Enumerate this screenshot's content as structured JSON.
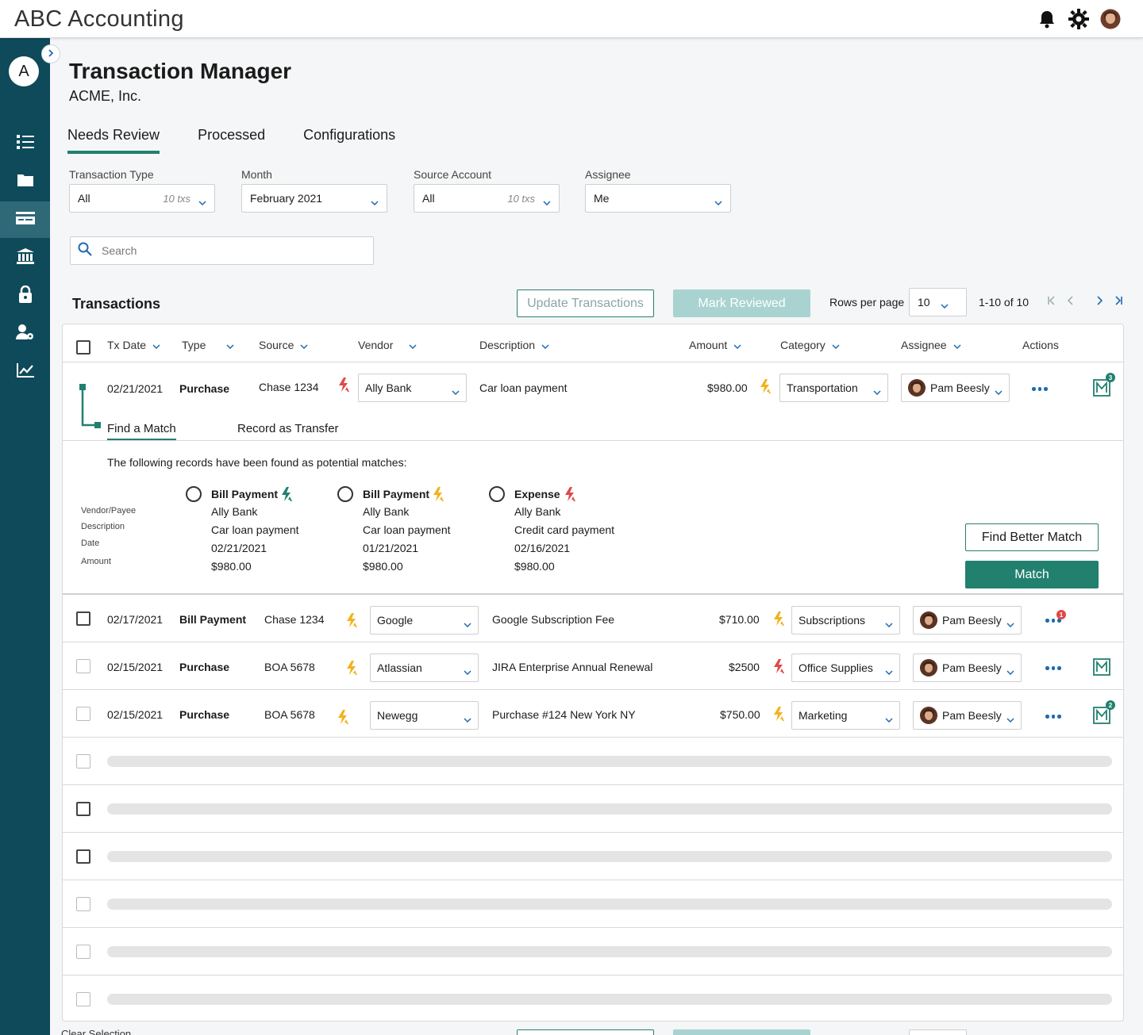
{
  "app": {
    "title": "ABC Accounting",
    "user_initial": "A"
  },
  "page": {
    "title": "Transaction Manager",
    "company": "ACME, Inc."
  },
  "tabs": [
    "Needs Review",
    "Processed",
    "Configurations"
  ],
  "filters": {
    "transaction_type": {
      "label": "Transaction Type",
      "value": "All",
      "count": "10 txs"
    },
    "month": {
      "label": "Month",
      "value": "February 2021"
    },
    "source_account": {
      "label": "Source Account",
      "value": "All",
      "count": "10 txs"
    },
    "assignee": {
      "label": "Assignee",
      "value": "Me"
    }
  },
  "search": {
    "placeholder": "Search"
  },
  "transactions": {
    "title": "Transactions",
    "update_label": "Update Transactions",
    "mark_reviewed_label": "Mark Reviewed",
    "rows_per_page_label": "Rows per page",
    "rows_per_page": "10",
    "range": "1-10 of 10",
    "headers": {
      "tx_date": "Tx Date",
      "type": "Type",
      "source": "Source",
      "vendor": "Vendor",
      "description": "Description",
      "amount": "Amount",
      "category": "Category",
      "assignee": "Assignee",
      "actions": "Actions"
    },
    "rows": [
      {
        "date": "02/21/2021",
        "type": "Purchase",
        "source": "Chase 1234",
        "vendor": "Ally Bank",
        "description": "Car loan payment",
        "amount": "$980.00",
        "category": "Transportation",
        "assignee": "Pam Beesly",
        "m_badge": "3"
      },
      {
        "date": "02/17/2021",
        "type": "Bill Payment",
        "source": "Chase 1234",
        "vendor": "Google",
        "description": "Google Subscription Fee",
        "amount": "$710.00",
        "category": "Subscriptions",
        "assignee": "Pam Beesly",
        "dots_badge": "1"
      },
      {
        "date": "02/15/2021",
        "type": "Purchase",
        "source": "BOA 5678",
        "vendor": "Atlassian",
        "description": "JIRA Enterprise Annual Renewal",
        "amount": "$2500",
        "category": "Office Supplies",
        "assignee": "Pam Beesly"
      },
      {
        "date": "02/15/2021",
        "type": "Purchase",
        "source": "BOA 5678",
        "vendor": "Newegg",
        "description": "Purchase #124 New York NY",
        "amount": "$750.00",
        "category": "Marketing",
        "assignee": "Pam Beesly",
        "m_badge": "2"
      }
    ],
    "clear_selection": "Clear Selection"
  },
  "expansion": {
    "tabs": [
      "Find a Match",
      "Record as Transfer"
    ],
    "intro": "The following records have been found as potential matches:",
    "field_labels": [
      "Vendor/Payee",
      "Description",
      "Date",
      "Amount"
    ],
    "matches": [
      {
        "type": "Bill Payment",
        "vendor": "Ally Bank",
        "description": "Car loan payment",
        "date": "02/21/2021",
        "amount": "$980.00"
      },
      {
        "type": "Bill Payment",
        "vendor": "Ally Bank",
        "description": "Car loan payment",
        "date": "01/21/2021",
        "amount": "$980.00"
      },
      {
        "type": "Expense",
        "vendor": "Ally Bank",
        "description": "Credit card payment",
        "date": "02/16/2021",
        "amount": "$980.00"
      }
    ],
    "find_better_label": "Find Better Match",
    "match_label": "Match"
  },
  "colors": {
    "sidebar": "#0e4a5a",
    "accent": "#22806f",
    "link_blue": "#1f6bb0",
    "bolt_yellow": "#f2b21b",
    "bolt_red": "#e04848",
    "bolt_green": "#22806f"
  },
  "icons": {
    "top": [
      "bell-icon",
      "gear-icon",
      "user-avatar"
    ],
    "sidebar": [
      "checklist-icon",
      "folder-icon",
      "card-icon",
      "bank-icon",
      "lock-icon",
      "user-settings-icon",
      "chart-icon"
    ]
  }
}
